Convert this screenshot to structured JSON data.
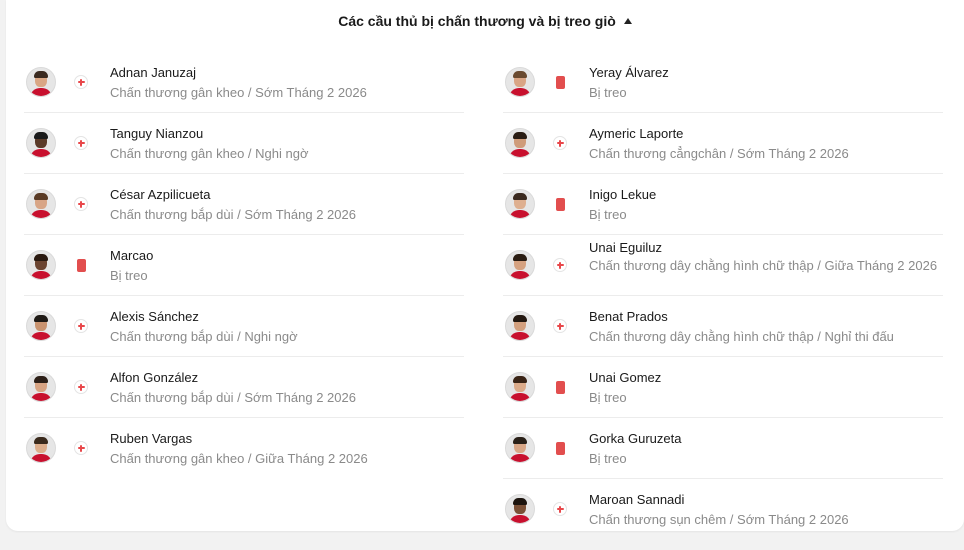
{
  "header": {
    "title": "Các cầu thủ bị chấn thương và bị treo giò"
  },
  "left": [
    {
      "name": "Adnan Januzaj",
      "detail": "Chấn thương gân kheo / Sớm Tháng 2 2026",
      "status": "injury",
      "skin": "#d9a684",
      "hair": "#3a2a20"
    },
    {
      "name": "Tanguy Nianzou",
      "detail": "Chấn thương gân kheo / Nghi ngờ",
      "status": "injury",
      "skin": "#5a3a28",
      "hair": "#1a1a1a"
    },
    {
      "name": "César Azpilicueta",
      "detail": "Chấn thương bắp dùi / Sớm Tháng 2 2026",
      "status": "injury",
      "skin": "#d8a586",
      "hair": "#5a3b25"
    },
    {
      "name": "Marcao",
      "detail": "Bị treo",
      "status": "suspended",
      "skin": "#6b4430",
      "hair": "#2a1a10"
    },
    {
      "name": "Alexis Sánchez",
      "detail": "Chấn thương bắp dùi / Nghi ngờ",
      "status": "injury",
      "skin": "#c9936f",
      "hair": "#1f1a15"
    },
    {
      "name": "Alfon González",
      "detail": "Chấn thương bắp dùi / Sớm Tháng 2 2026",
      "status": "injury",
      "skin": "#d8a483",
      "hair": "#2d2018"
    },
    {
      "name": "Ruben Vargas",
      "detail": "Chấn thương gân kheo / Giữa Tháng 2 2026",
      "status": "injury",
      "skin": "#dcae8c",
      "hair": "#3a2a1c"
    }
  ],
  "right": [
    {
      "name": "Yeray Álvarez",
      "detail": "Bị treo",
      "status": "suspended",
      "skin": "#d9a585",
      "hair": "#6a4a30"
    },
    {
      "name": "Aymeric Laporte",
      "detail": "Chấn thương cẳngchân / Sớm Tháng 2 2026",
      "status": "injury",
      "skin": "#cf9c7a",
      "hair": "#2a1d14"
    },
    {
      "name": "Inigo Lekue",
      "detail": "Bị treo",
      "status": "suspended",
      "skin": "#deaf8f",
      "hair": "#3b2a1f"
    },
    {
      "name": "Unai Eguiluz",
      "detail": "Chấn thương dây chằng hình chữ thập / Giữa Tháng 2 2026",
      "status": "injury",
      "skin": "#d6a280",
      "hair": "#2a1c12",
      "tall": true
    },
    {
      "name": "Benat Prados",
      "detail": "Chấn thương dây chằng hình chữ thập / Nghỉ thi đấu",
      "status": "injury",
      "skin": "#d3a07e",
      "hair": "#231810"
    },
    {
      "name": "Unai Gomez",
      "detail": "Bị treo",
      "status": "suspended",
      "skin": "#dcab8a",
      "hair": "#3a2416"
    },
    {
      "name": "Gorka Guruzeta",
      "detail": "Bị treo",
      "status": "suspended",
      "skin": "#d9a787",
      "hair": "#2a2018"
    },
    {
      "name": "Maroan Sannadi",
      "detail": "Chấn thương sụn chêm / Sớm Tháng 2 2026",
      "status": "injury",
      "skin": "#7a5036",
      "hair": "#1c140e"
    }
  ]
}
